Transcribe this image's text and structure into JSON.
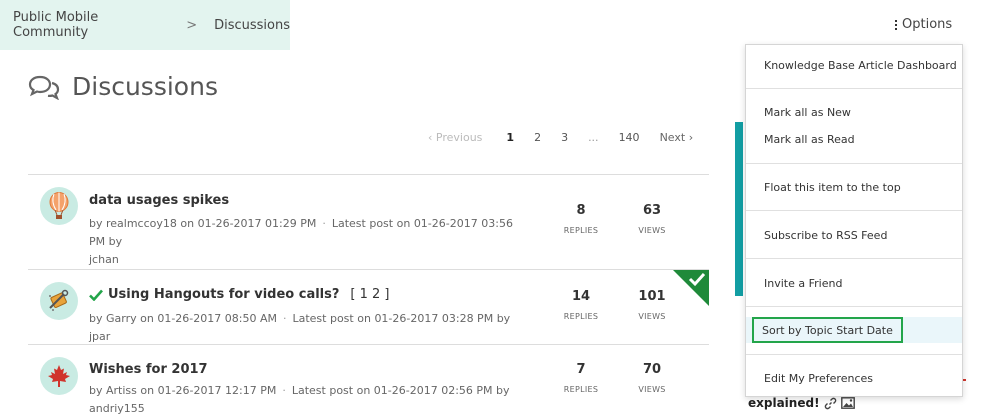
{
  "breadcrumb": {
    "home": "Public Mobile Community",
    "separator": ">",
    "current": "Discussions"
  },
  "options": {
    "label": "Options"
  },
  "page": {
    "title": "Discussions"
  },
  "pagination": {
    "previous": "Previous",
    "pages": [
      "1",
      "2",
      "3"
    ],
    "ellipsis": "...",
    "last": "140",
    "next": "Next",
    "current": "1"
  },
  "topics": [
    {
      "subject": "data usages spikes",
      "solved": false,
      "pages": "",
      "by_label": "by",
      "author": "realmccoy18",
      "on_label": "on",
      "post_date": "01-26-2017 01:29 PM",
      "latest_label": "Latest post on",
      "latest_date": "01-26-2017 03:56 PM",
      "latest_by_label": "by",
      "latest_author": "jchan",
      "replies": "8",
      "replies_label": "REPLIES",
      "views": "63",
      "views_label": "VIEWS",
      "avatar_icon": "hot-air-balloon-icon"
    },
    {
      "subject": "Using Hangouts for video calls?",
      "solved": true,
      "pages": "[ 1 2 ]",
      "by_label": "by",
      "author": "Garry",
      "on_label": "on",
      "post_date": "01-26-2017 08:50 AM",
      "latest_label": "Latest post on",
      "latest_date": "01-26-2017 03:28 PM",
      "latest_by_label": "by",
      "latest_author": "jpar",
      "replies": "14",
      "replies_label": "REPLIES",
      "views": "101",
      "views_label": "VIEWS",
      "avatar_icon": "tools-icon"
    },
    {
      "subject": "Wishes for 2017",
      "solved": false,
      "pages": "",
      "by_label": "by",
      "author": "Artiss",
      "on_label": "on",
      "post_date": "01-26-2017 12:17 PM",
      "latest_label": "Latest post on",
      "latest_date": "01-26-2017 02:56 PM",
      "latest_by_label": "by",
      "latest_author": "andriy155",
      "replies": "7",
      "replies_label": "REPLIES",
      "views": "70",
      "views_label": "VIEWS",
      "avatar_icon": "maple-leaf-icon"
    }
  ],
  "options_menu": {
    "items": [
      "Knowledge Base Article Dashboard",
      "Mark all as New",
      "Mark all as Read",
      "Float this item to the top",
      "Subscribe to RSS Feed",
      "Invite a Friend",
      "Sort by Topic Start Date",
      "Edit My Preferences"
    ],
    "highlighted": "Sort by Topic Start Date"
  },
  "sidebar": {
    "partial_text": "explained!"
  },
  "colors": {
    "accent_teal": "#129ea3",
    "solved_green": "#23a54a",
    "breadcrumb_bg": "#e3f4ef",
    "avatar_bg": "#c9ebe3"
  }
}
